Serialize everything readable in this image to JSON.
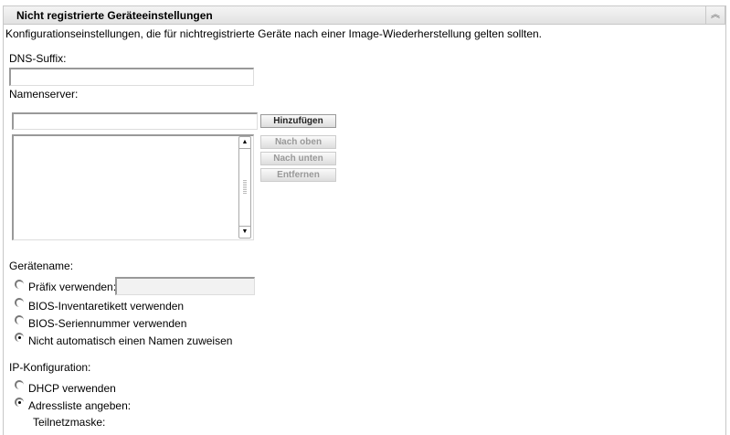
{
  "panel": {
    "title": "Nicht registrierte Geräteeinstellungen",
    "collapse_icon": "double-chevron-up-icon"
  },
  "description": "Konfigurationseinstellungen, die für nichtregistrierte Geräte nach einer Image-Wiederherstellung gelten sollten.",
  "dns": {
    "label": "DNS-Suffix:",
    "value": ""
  },
  "nameserver": {
    "label": "Namenserver:",
    "value": "",
    "add": "Hinzufügen",
    "up": "Nach oben",
    "down": "Nach unten",
    "remove": "Entfernen",
    "list": []
  },
  "device_name": {
    "label": "Gerätename:",
    "options": [
      "Präfix verwenden:",
      "BIOS-Inventaretikett verwenden",
      "BIOS-Seriennummer verwenden",
      "Nicht automatisch einen Namen zuweisen"
    ],
    "selected": 3,
    "prefix_value": ""
  },
  "ip": {
    "label": "IP-Konfiguration:",
    "options": [
      "DHCP verwenden",
      "Adressliste angeben:"
    ],
    "selected": 1,
    "subnet_label": "Teilnetzmaske:"
  }
}
